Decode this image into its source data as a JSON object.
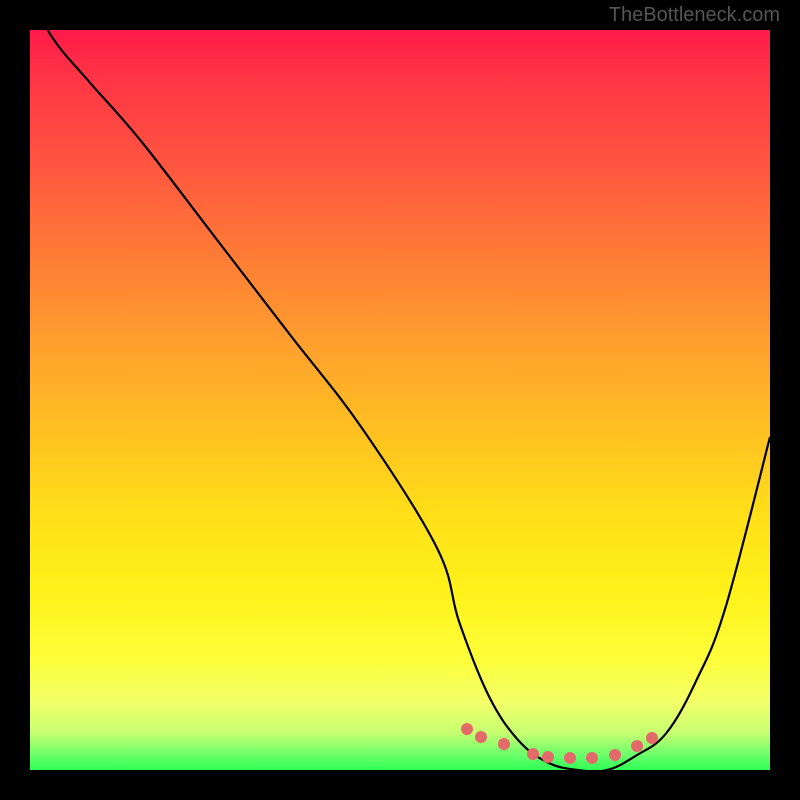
{
  "watermark": "TheBottleneck.com",
  "chart_data": {
    "type": "line",
    "title": "",
    "xlabel": "",
    "ylabel": "",
    "xlim": [
      0,
      100
    ],
    "ylim": [
      0,
      100
    ],
    "series": [
      {
        "name": "bottleneck-curve",
        "x": [
          0,
          3,
          8,
          15,
          25,
          35,
          45,
          55,
          58,
          62,
          66,
          70,
          74,
          78,
          82,
          86,
          90,
          94,
          100
        ],
        "y": [
          105,
          99,
          93,
          85,
          72,
          59,
          46,
          30,
          20,
          10,
          4,
          1,
          0,
          0,
          2,
          5,
          12,
          22,
          45
        ]
      }
    ],
    "highlight_points": {
      "name": "optimal-range-dots",
      "color": "#e46a6a",
      "x": [
        59,
        61,
        64,
        68,
        70,
        73,
        76,
        79,
        82,
        84
      ],
      "y": [
        5.5,
        4.5,
        3.5,
        2.2,
        1.8,
        1.6,
        1.6,
        2.0,
        3.2,
        4.3
      ]
    },
    "background": "rainbow-vertical-gradient"
  }
}
